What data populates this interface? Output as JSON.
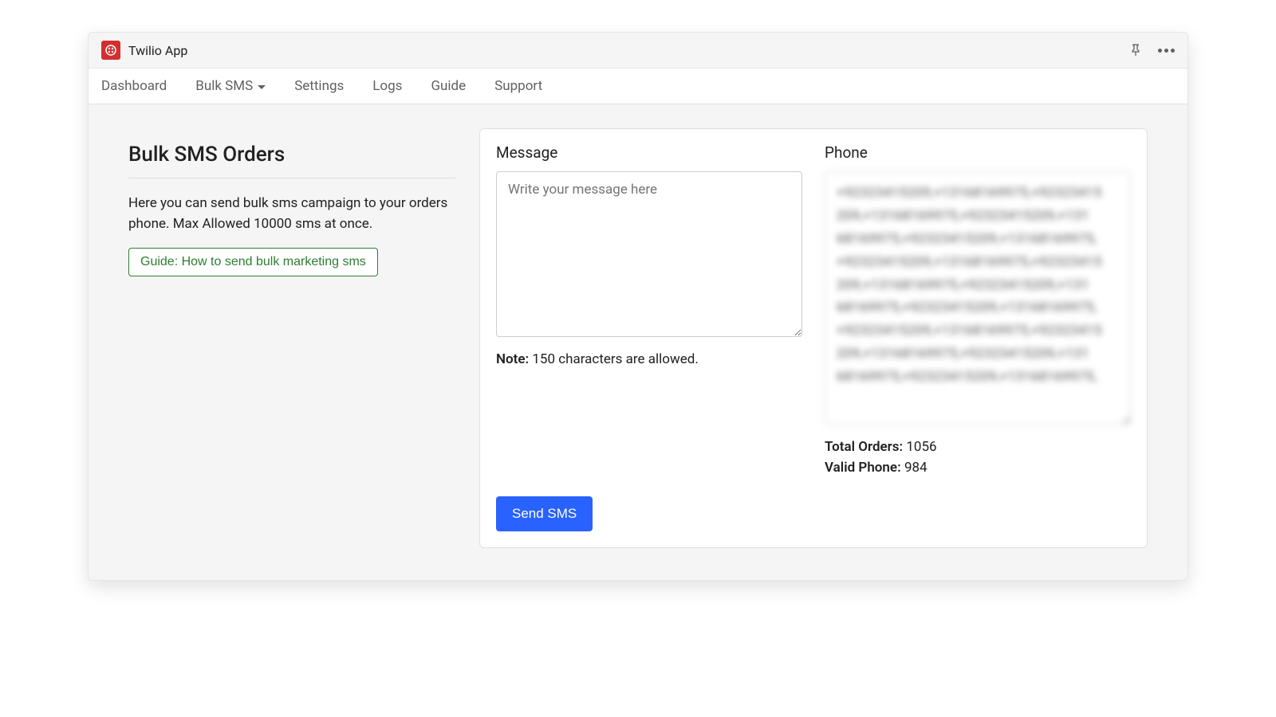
{
  "header": {
    "app_title": "Twilio App"
  },
  "nav": {
    "items": [
      "Dashboard",
      "Bulk SMS",
      "Settings",
      "Logs",
      "Guide",
      "Support"
    ],
    "dropdown_index": 1
  },
  "sidebar": {
    "title": "Bulk SMS Orders",
    "description": "Here you can send bulk sms campaign to your orders phone. Max Allowed 10000 sms at once.",
    "guide_button_label": "Guide: How to send bulk marketing sms"
  },
  "form": {
    "message": {
      "label": "Message",
      "placeholder": "Write your message here",
      "note_prefix": "Note:",
      "note_text": " 150 characters are allowed.",
      "char_limit": 150
    },
    "phone": {
      "label": "Phone",
      "value": "+92323415209,+13168169975,+92323415 209,+13168169975,+92323415209,+131 68169975,+92323415209,+13168169975, +92323415209,+13168169975,+92323415 209,+13168169975,+92323415209,+131 68169975,+92323415209,+13168169975, +92323415209,+13168169975,+92323415 209,+13168169975,+92323415209,+131 68169975,+92323415209,+13168169975,"
    },
    "stats": {
      "total_orders_label": "Total Orders:",
      "total_orders_value": "1056",
      "valid_phone_label": "Valid Phone:",
      "valid_phone_value": "984"
    },
    "submit_label": "Send SMS"
  }
}
